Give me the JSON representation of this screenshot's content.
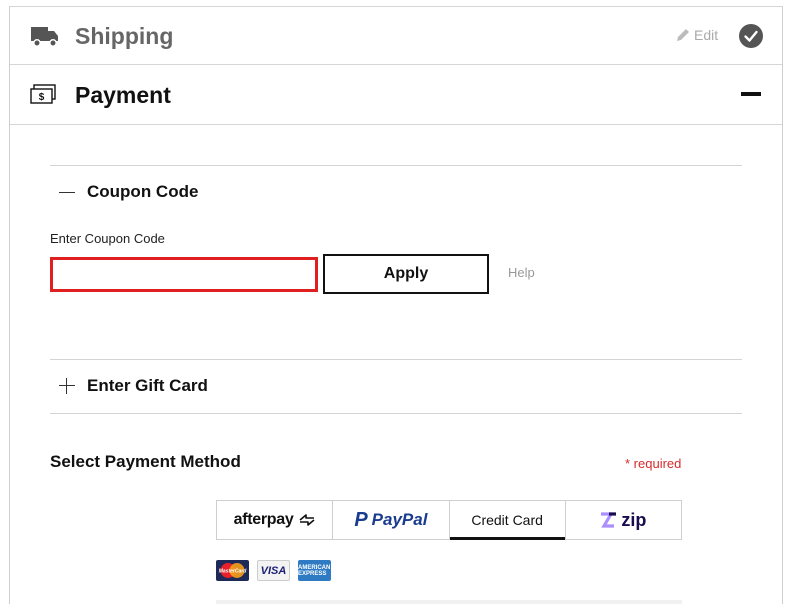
{
  "shipping": {
    "title": "Shipping",
    "edit_label": "Edit",
    "icon": "truck-icon",
    "status_icon": "check-circle-icon"
  },
  "payment": {
    "title": "Payment",
    "icon": "money-icon",
    "toggle_icon": "collapse-icon"
  },
  "coupon": {
    "title": "Coupon Code",
    "field_label": "Enter Coupon Code",
    "input_value": "",
    "apply_label": "Apply",
    "help_label": "Help",
    "error_border_color": "#e02020"
  },
  "gift_card": {
    "title": "Enter Gift Card"
  },
  "payment_method": {
    "title": "Select Payment Method",
    "required_label": "* required",
    "tabs": [
      {
        "label": "afterpay",
        "selected": false
      },
      {
        "label": "PayPal",
        "selected": false
      },
      {
        "label": "Credit Card",
        "selected": true
      },
      {
        "label": "zip",
        "selected": false
      }
    ],
    "card_icons": [
      "mastercard-icon",
      "visa-icon",
      "amex-icon"
    ],
    "card_texts": {
      "mastercard": "MasterCard",
      "visa": "VISA",
      "amex": "AMERICAN EXPRESS"
    }
  }
}
